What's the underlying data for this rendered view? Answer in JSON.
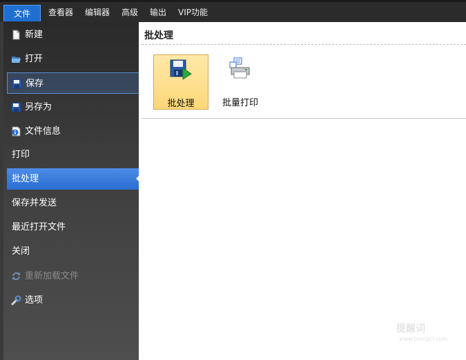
{
  "menubar": {
    "file": "文件",
    "items": [
      "查看器",
      "编辑器",
      "高级",
      "输出",
      "VIP功能"
    ]
  },
  "sidebar": {
    "items": [
      {
        "label": "新建",
        "icon": "new-document-icon"
      },
      {
        "label": "打开",
        "icon": "open-folder-icon"
      },
      {
        "label": "保存",
        "icon": "save-disk-icon",
        "state": "hover"
      },
      {
        "label": "另存为",
        "icon": "save-as-disk-icon"
      },
      {
        "label": "文件信息",
        "icon": "info-icon"
      },
      {
        "label": "打印"
      },
      {
        "label": "批处理",
        "state": "active"
      },
      {
        "label": "保存并发送"
      },
      {
        "label": "最近打开文件"
      },
      {
        "label": "关闭"
      },
      {
        "label": "重新加载文件",
        "icon": "reload-icon",
        "state": "disabled"
      },
      {
        "label": "选项",
        "icon": "wrench-icon"
      }
    ]
  },
  "main": {
    "title": "批处理",
    "tiles": [
      {
        "label": "批处理",
        "icon": "batch-save-play-icon",
        "selected": true
      },
      {
        "label": "批量打印",
        "icon": "batch-print-icon"
      }
    ]
  },
  "watermark": {
    "text": "提醒词",
    "sub": "www.tixingci.com"
  },
  "colors": {
    "accent": "#2a6ed2",
    "menubar": "#2b2b2b",
    "tile_selected": "#fcd779"
  }
}
